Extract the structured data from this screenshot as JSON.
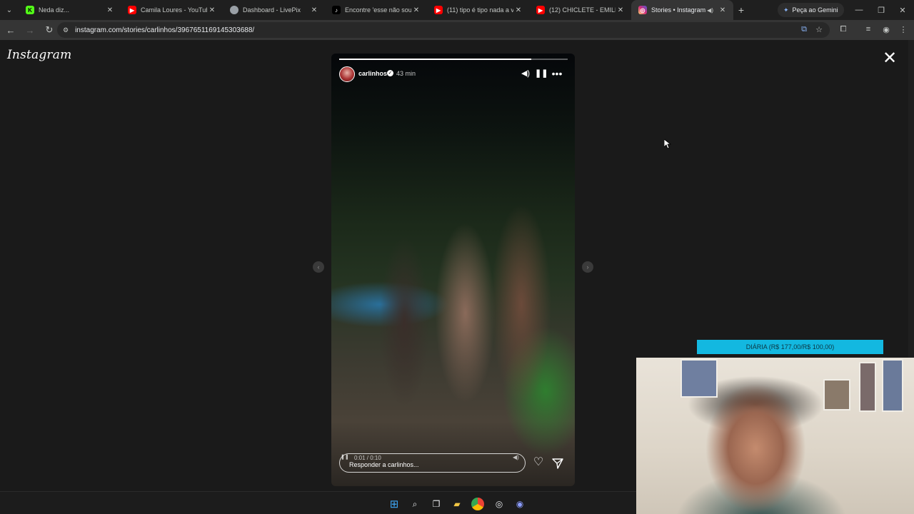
{
  "browser": {
    "tabs": [
      {
        "title": "Neda diz...",
        "favicon_color": "#53fc18",
        "favicon_glyph": "K",
        "active": false
      },
      {
        "title": "Camila Loures - YouTube",
        "favicon_color": "#ff0000",
        "favicon_glyph": "▶",
        "active": false
      },
      {
        "title": "Dashboard - LivePix",
        "favicon_color": "#9aa0a6",
        "favicon_glyph": "●",
        "active": false
      },
      {
        "title": "Encontre 'esse não sou eu",
        "favicon_color": "#000000",
        "favicon_glyph": "♪",
        "active": false
      },
      {
        "title": "(11) tipo é tipo nada a ver",
        "favicon_color": "#ff0000",
        "favicon_glyph": "▶",
        "active": false
      },
      {
        "title": "(12) CHICLETE - EMILLY VIC",
        "favicon_color": "#ff0000",
        "favicon_glyph": "▶",
        "active": false
      },
      {
        "title": "Stories • Instagram",
        "favicon_color": "#d62976",
        "favicon_glyph": "◎",
        "active": true
      }
    ],
    "gemini_label": "Peça ao Gemini",
    "url": "instagram.com/stories/carlinhos/3967651169145303688/"
  },
  "instagram": {
    "logo": "Instagram",
    "story": {
      "username": "carlinhos",
      "time_ago": "43 min",
      "progress_fraction": 0.84,
      "video_time": "0:01 / 0:10",
      "reply_placeholder": "Responder a carlinhos..."
    }
  },
  "overlay": {
    "banner_text": "DIÁRIA (R$ 177,00/R$ 100,00)",
    "banner_color": "#13b8e0"
  },
  "taskbar": {
    "icons": [
      "windows-start-icon",
      "search-icon",
      "task-view-icon",
      "file-explorer-icon",
      "chrome-icon",
      "obs-icon",
      "discord-icon"
    ]
  }
}
